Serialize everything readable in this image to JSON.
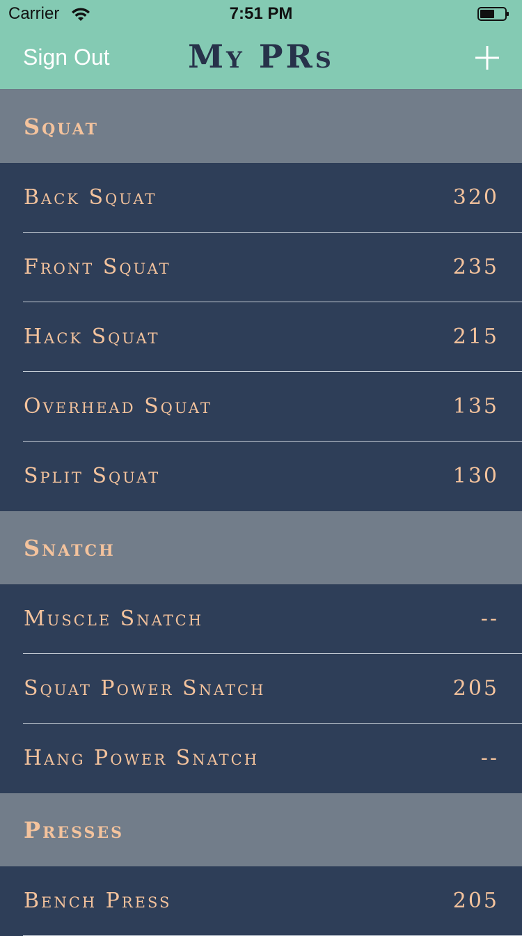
{
  "status_bar": {
    "carrier": "Carrier",
    "time": "7:51 PM",
    "icons": [
      "wifi-icon",
      "battery-icon"
    ]
  },
  "nav": {
    "left_button": "Sign Out",
    "title": "My PRs",
    "right_icon": "plus-icon"
  },
  "colors": {
    "nav_background": "#84cab3",
    "section_background": "#727d8a",
    "row_background": "#2e3e58",
    "text_accent": "#f4c39d",
    "title_color": "#27324a"
  },
  "sections": [
    {
      "title": "Squat",
      "items": [
        {
          "name": "Back Squat",
          "value": "320"
        },
        {
          "name": "Front Squat",
          "value": "235"
        },
        {
          "name": "Hack Squat",
          "value": "215"
        },
        {
          "name": "Overhead Squat",
          "value": "135"
        },
        {
          "name": "Split Squat",
          "value": "130"
        }
      ]
    },
    {
      "title": "Snatch",
      "items": [
        {
          "name": "Muscle Snatch",
          "value": "--"
        },
        {
          "name": "Squat Power Snatch",
          "value": "205"
        },
        {
          "name": "Hang Power Snatch",
          "value": "--"
        }
      ]
    },
    {
      "title": "Presses",
      "items": [
        {
          "name": "Bench Press",
          "value": "205"
        }
      ]
    }
  ]
}
